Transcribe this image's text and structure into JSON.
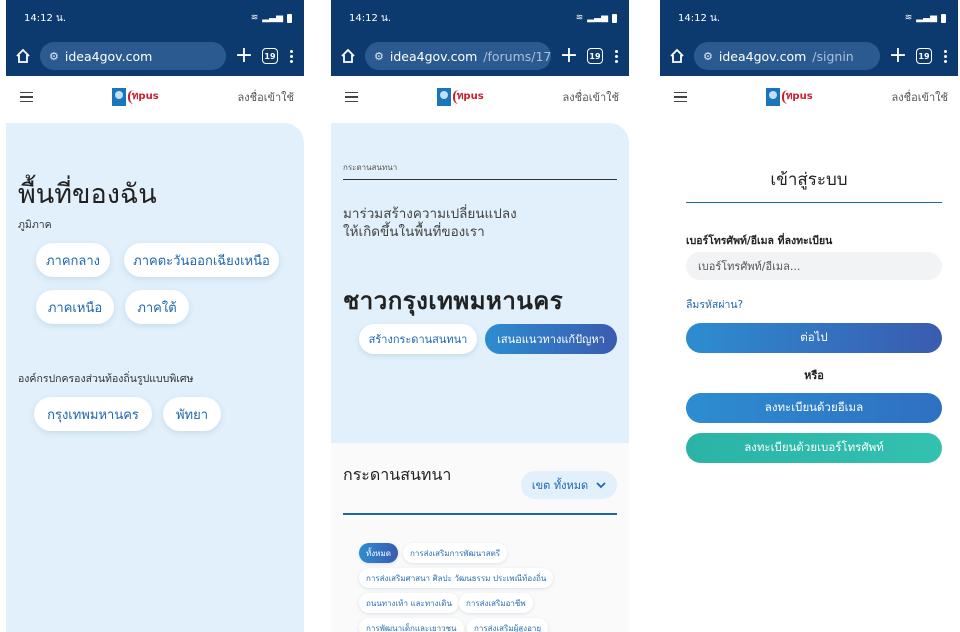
{
  "status": {
    "time": "14:12 น."
  },
  "colors": {
    "browser_bar": "#0d3a6e",
    "panel_bg": "#e1f0fa",
    "accent": "#1f66b0",
    "teal": "#2bb4a6"
  },
  "icons": [
    "home-icon",
    "site-settings-icon",
    "plus-icon",
    "tab-switcher-icon",
    "more-icon",
    "hamburger-icon",
    "chevron-down-icon"
  ],
  "phones": [
    {
      "url": {
        "domain": "idea4gov.com",
        "path": ""
      },
      "tab_count": "19",
      "login_link": "ลงชื่อเข้าใช้",
      "page_title": "พื้นที่ของฉัน",
      "region_label": "ภูมิภาค",
      "regions": [
        "ภาคกลาง",
        "ภาคตะวันออกเฉียงเหนือ",
        "ภาคเหนือ",
        "ภาคใต้"
      ],
      "special_label": "องค์กรปกครองส่วนท้องถิ่นรูปแบบพิเศษ",
      "special_areas": [
        "กรุงเทพมหานคร",
        "พัทยา"
      ]
    },
    {
      "url": {
        "domain": "idea4gov.com",
        "path": "/forums/17"
      },
      "tab_count": "19",
      "login_link": "ลงชื่อเข้าใช้",
      "breadcrumb": "กระดานสนทนา",
      "intro_line1": "มาร่วมสร้างความเปลี่ยนแปลง",
      "intro_line2": "ให้เกิดขึ้นในพื้นที่ของเรา",
      "heading": "ชาวกรุงเทพมหานคร",
      "create_board": "สร้างกระดานสนทนา",
      "propose_solution": "เสนอแนวทางแก้ปัญหา",
      "board_title": "กระดานสนทนา",
      "district_filter": "เขต ทั้งหมด",
      "tags": [
        "ทั้งหมด",
        "การส่งเสริมการพัฒนาสตรี",
        "การส่งเสริมศาสนา ศิลปะ วัฒนธรรม ประเพณีท้องถิ่น",
        "ถนนทางเท้า และทางเดิน",
        "การส่งเสริมอาชีพ",
        "การพัฒนาเด็กและเยาวชน",
        "การส่งเสริมผู้สูงอายุ"
      ]
    },
    {
      "url": {
        "domain": "idea4gov.com",
        "path": "/signin"
      },
      "tab_count": "19",
      "login_link": "ลงชื่อเข้าใช้",
      "title": "เข้าสู่ระบบ",
      "field_label": "เบอร์โทรศัพท์/อีเมล ที่ลงทะเบียน",
      "field_placeholder": "เบอร์โทรศัพท์/อีเมล...",
      "forgot": "ลืมรหัสผ่าน?",
      "next": "ต่อไป",
      "or": "หรือ",
      "register_email": "ลงทะเบียนด้วยอีเมล",
      "register_phone": "ลงทะเบียนด้วยเบอร์โทรศัพท์"
    }
  ]
}
